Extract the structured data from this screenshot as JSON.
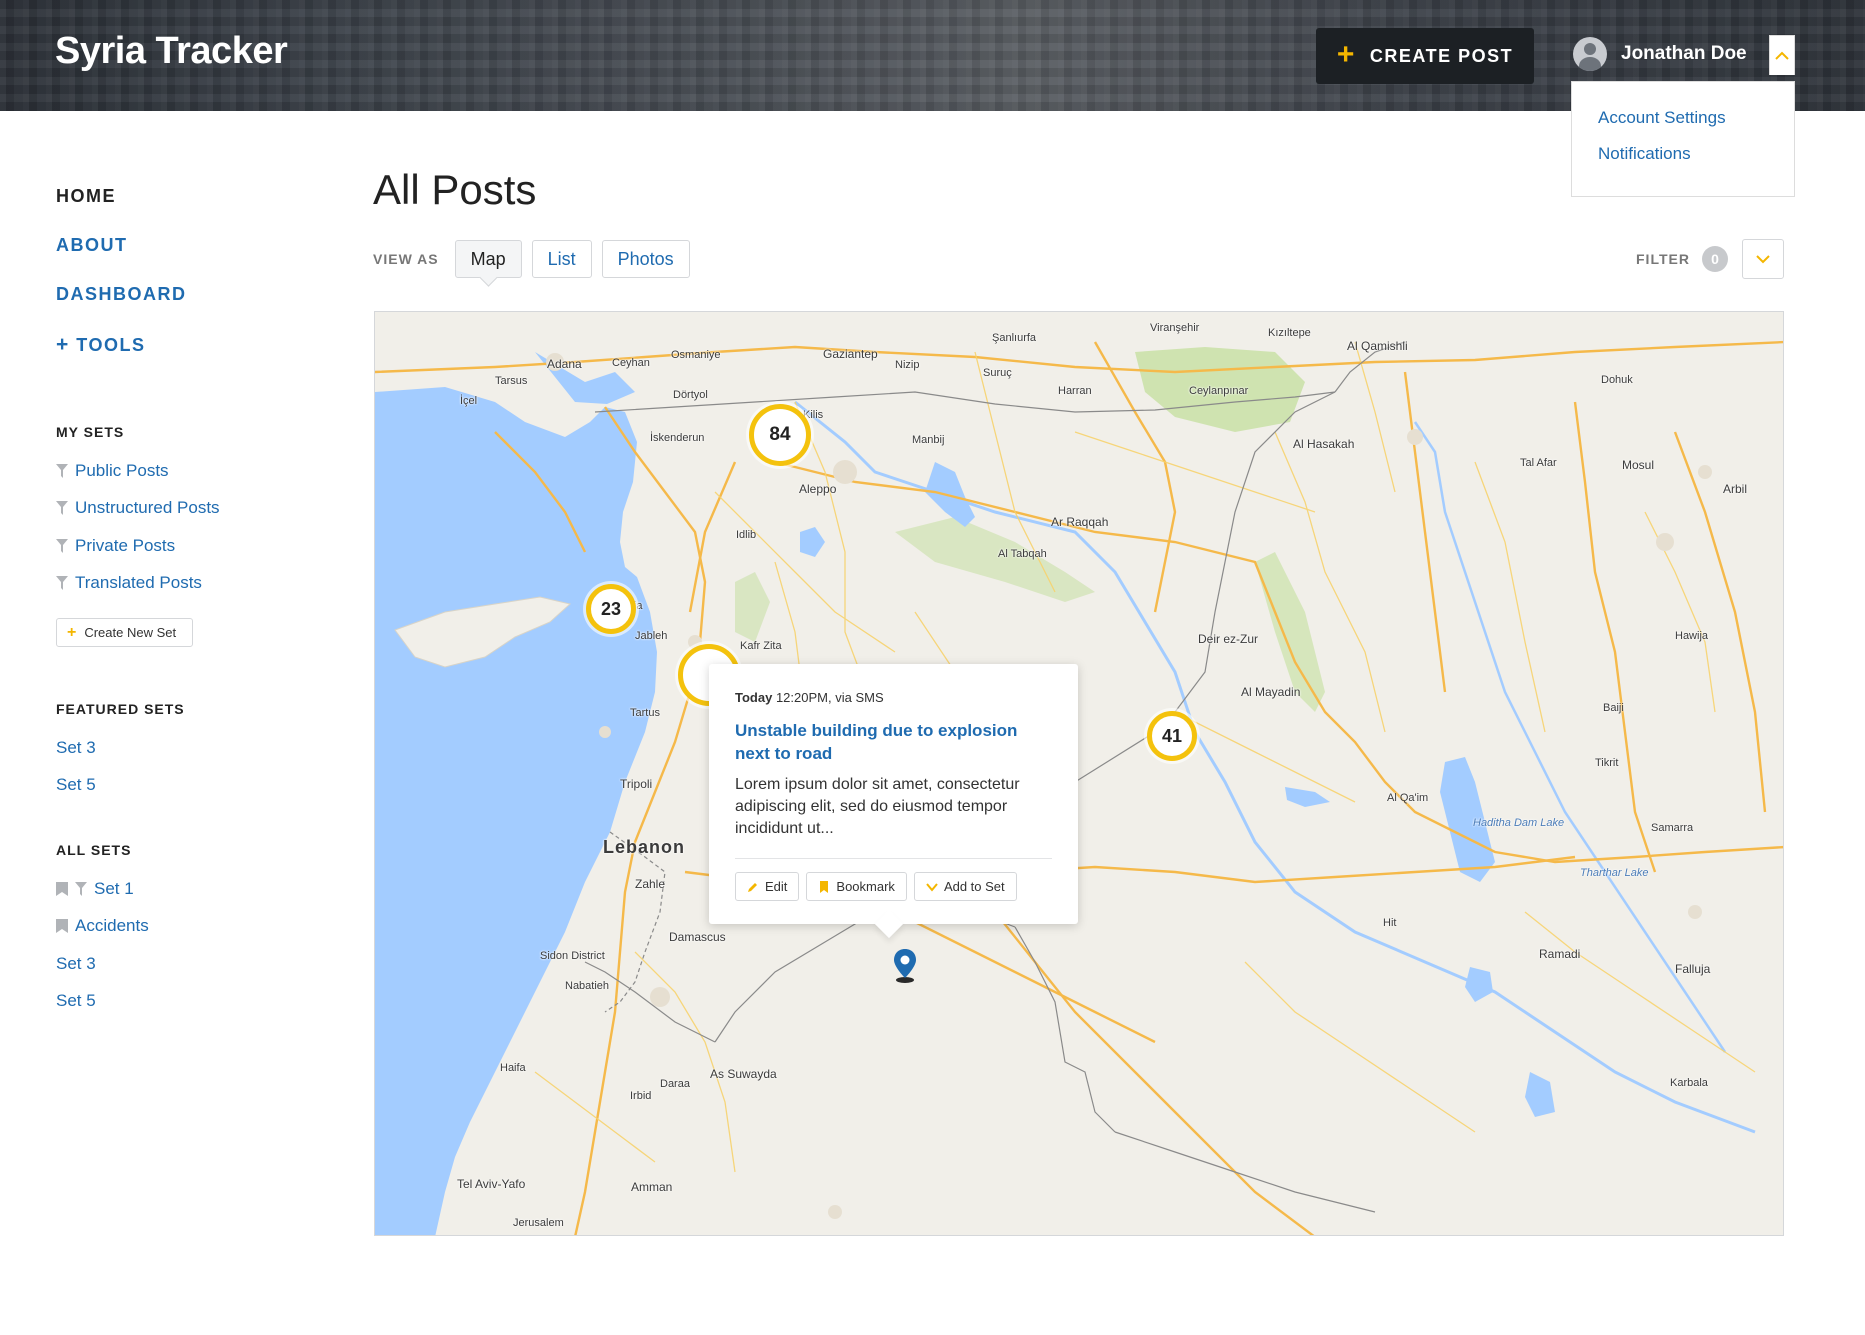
{
  "header": {
    "brand": "Syria Tracker",
    "create_post_label": "CREATE POST",
    "user_name": "Jonathan Doe",
    "user_menu": [
      "Account Settings",
      "Notifications"
    ]
  },
  "sidebar": {
    "nav": [
      {
        "label": "HOME"
      },
      {
        "label": "ABOUT"
      },
      {
        "label": "DASHBOARD"
      },
      {
        "label": "TOOLS"
      }
    ],
    "my_sets_title": "MY SETS",
    "my_sets": [
      "Public Posts",
      "Unstructured Posts",
      "Private Posts",
      "Translated Posts"
    ],
    "create_set_label": "Create New Set",
    "featured_title": "FEATURED SETS",
    "featured_sets": [
      "Set 3",
      "Set 5"
    ],
    "all_sets_title": "ALL SETS",
    "all_sets": [
      "Set 1",
      "Accidents",
      "Set 3",
      "Set 5"
    ]
  },
  "main": {
    "title": "All Posts",
    "view_as_label": "VIEW AS",
    "views": [
      "Map",
      "List",
      "Photos"
    ],
    "filter_label": "FILTER",
    "filter_count": "0"
  },
  "map": {
    "clusters": [
      "84",
      "23",
      "41"
    ],
    "labels": {
      "lebanon": "Lebanon",
      "aleppo": "Aleppo",
      "gaziantep": "Gaziantep",
      "adana": "Adana",
      "mosul": "Mosul",
      "erbil": "Arbil",
      "raqqah": "Ar Raqqah",
      "hasakah": "Al Hasakah",
      "deir": "Deir ez-Zur",
      "mayadin": "Al Mayadin",
      "qamishli": "Al Qamishli",
      "damascus": "Damascus",
      "suwayda": "As Suwayda",
      "amman": "Amman",
      "tripoli": "Tripoli",
      "zahle": "Zahle",
      "tartus": "Tartus",
      "sidon": "Sidon District",
      "haifa": "Haifa",
      "telaviv": "Tel Aviv-Yafo",
      "jerusalem": "Jerusalem",
      "ramadi": "Ramadi",
      "falluja": "Falluja",
      "karbala": "Karbala",
      "samarra": "Samarra",
      "tikrit": "Tikrit",
      "hit": "Hit",
      "idlib": "Idlib",
      "hama": "Kafr Zita",
      "sanliurfa": "Şanlıurfa",
      "kiziltepe": "Kızıltepe",
      "dohuk": "Dohuk",
      "baiji": "Baiji",
      "hawija": "Hawija",
      "manbij": "Manbij",
      "kilis": "Kilis",
      "iskenderun": "İskenderun",
      "icel": "İçel",
      "tabqah": "Al Tabqah",
      "qaim": "Al Qa'im",
      "daraa": "Daraa",
      "irbid": "Irbid",
      "nabatieh": "Nabatieh",
      "lattakia": "Latakia",
      "jableh": "Jableh",
      "harran": "Harran",
      "suruc": "Suruç",
      "ceylanpinar": "Ceylanpınar",
      "osmaniye": "Osmaniye",
      "ceyhan": "Ceyhan",
      "tarsus": "Tarsus",
      "dortyol": "Dörtyol",
      "nizip": "Nizip",
      "viransehir": "Viranşehir",
      "talafar": "Tal Afar",
      "haditha": "Haditha Dam Lake",
      "tharthar": "Tharthar Lake"
    }
  },
  "popup": {
    "date_bold": "Today",
    "date_rest": "12:20PM, via SMS",
    "title": "Unstable building due to explosion next to road",
    "body": "Lorem ipsum dolor sit amet, consectetur adipiscing elit, sed do eiusmod tempor incididunt ut...",
    "actions": [
      "Edit",
      "Bookmark",
      "Add to Set"
    ]
  },
  "colors": {
    "accent": "#f4b600",
    "link": "#1f6bb0",
    "water": "#a3ccff",
    "land": "#f1efe9"
  }
}
